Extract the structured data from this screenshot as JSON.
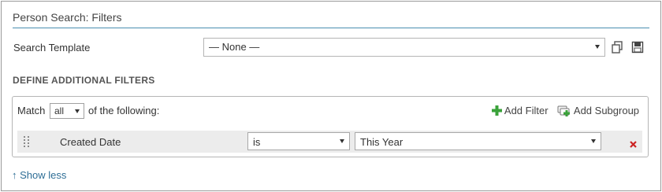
{
  "panel": {
    "title": "Person Search: Filters"
  },
  "search_template": {
    "label": "Search Template",
    "selected": "— None —",
    "copy_icon": "copy-icon",
    "save_icon": "save-disk-icon"
  },
  "filters": {
    "section_heading": "DEFINE ADDITIONAL FILTERS",
    "match_prefix": "Match",
    "match_value": "all",
    "match_suffix": "of the following:",
    "add_filter_label": "Add Filter",
    "add_subgroup_label": "Add Subgroup",
    "rows": [
      {
        "field": "Created Date",
        "operator": "is",
        "value": "This Year"
      }
    ]
  },
  "footer": {
    "show_less_arrow": "↑",
    "show_less_label": "Show less"
  },
  "colors": {
    "title_rule": "#4a8fb0",
    "link": "#2e6e96",
    "add_icon": "#3aa23a",
    "delete_icon": "#cc2222"
  }
}
